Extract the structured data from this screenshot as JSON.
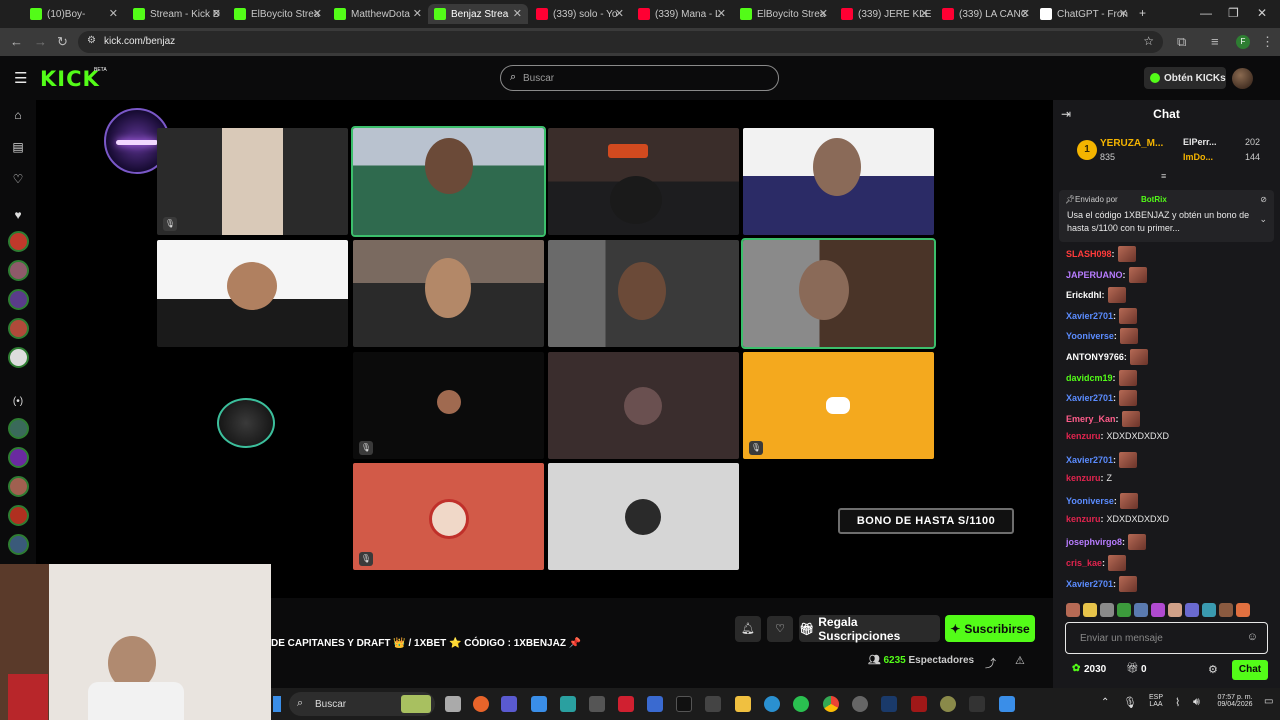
{
  "browser": {
    "tabs": [
      {
        "title": "(10)Boy-",
        "color": "#53fc18"
      },
      {
        "title": "Stream - Kick D",
        "color": "#53fc18"
      },
      {
        "title": "ElBoycito Strea",
        "color": "#53fc18"
      },
      {
        "title": "MatthewDota",
        "color": "#53fc18"
      },
      {
        "title": "Benjaz Strea",
        "color": "#53fc18",
        "active": true
      },
      {
        "title": "(339) solo - Yo",
        "color": "#ff0033"
      },
      {
        "title": "(339) Mana - L",
        "color": "#ff0033"
      },
      {
        "title": "ElBoycito Strea",
        "color": "#53fc18"
      },
      {
        "title": "(339) JERE KLE",
        "color": "#ff0033"
      },
      {
        "title": "(339) LA CANC",
        "color": "#ff0033"
      },
      {
        "title": "ChatGPT - Fron",
        "color": "#ffffff"
      }
    ],
    "new_tab": "+",
    "url": "kick.com/benjaz"
  },
  "header": {
    "logo": "KICK",
    "beta": "BETA",
    "search_placeholder": "Buscar",
    "kicks_button": "Obtén KICKs"
  },
  "video": {
    "promo_banner": "BONO DE HASTA S/1100"
  },
  "stream": {
    "title": "DE CAPITANES Y DRAFT 👑  / 1XBET ⭐ CÓDIGO : 1XBENJAZ 📌",
    "gift_label": "Regala Suscripciones",
    "subscribe_label": "Suscribirse",
    "viewers_count": "6235",
    "viewers_label": "Espectadores"
  },
  "chat": {
    "title": "Chat",
    "leaderboard": {
      "rank": "1",
      "top_user": "YERUZA_M...",
      "top_value": "835",
      "others": [
        {
          "name": "ElPerr...",
          "value": "202"
        },
        {
          "name": "ImDo...",
          "value": "144"
        }
      ]
    },
    "pinned": {
      "sent_by_label": "Enviado por",
      "sender": "BotRix",
      "text": "Usa el código 1XBENJAZ y obtén un bono de hasta s/1100 con tu primer..."
    },
    "messages": [
      {
        "user": "SLASH098",
        "color": "#ff3b3b",
        "text": "",
        "emote": true
      },
      {
        "user": "JAPERUANO",
        "color": "#b77cff",
        "text": "",
        "emote": true
      },
      {
        "user": "Erickdhl",
        "color": "#ffffff",
        "text": "",
        "emote": true
      },
      {
        "user": "Xavier2701",
        "color": "#5b8cff",
        "text": "",
        "emote": true
      },
      {
        "user": "Yooniverse",
        "color": "#5b8cff",
        "text": "",
        "emote": true
      },
      {
        "user": "ANTONY9766",
        "color": "#ffffff",
        "text": "",
        "emote": true
      },
      {
        "user": "davidcm19",
        "color": "#53fc18",
        "text": "",
        "emote": true
      },
      {
        "user": "Xavier2701",
        "color": "#5b8cff",
        "text": "",
        "emote": true
      },
      {
        "user": "Emery_Kan",
        "color": "#ff5c8a",
        "text": "",
        "emote": true
      },
      {
        "user": "kenzuru",
        "color": "#e0244e",
        "text": "XDXDXDXDXD",
        "emote": false
      },
      {
        "user": "Xavier2701",
        "color": "#5b8cff",
        "text": "",
        "emote": true
      },
      {
        "user": "kenzuru",
        "color": "#e0244e",
        "text": "Z",
        "emote": false
      },
      {
        "user": "Yooniverse",
        "color": "#5b8cff",
        "text": "",
        "emote": true
      },
      {
        "user": "kenzuru",
        "color": "#e0244e",
        "text": "XDXDXDXDXD",
        "emote": false
      },
      {
        "user": "josephvirgo8",
        "color": "#b77cff",
        "text": "",
        "emote": true
      },
      {
        "user": "cris_kae",
        "color": "#e0244e",
        "text": "",
        "emote": true
      },
      {
        "user": "Xavier2701",
        "color": "#5b8cff",
        "text": "",
        "emote": true
      }
    ],
    "input_placeholder": "Enviar un mensaje",
    "points": "2030",
    "gifts_count": "0",
    "send_label": "Chat"
  },
  "taskbar": {
    "search_label": "Buscar",
    "lang_top": "ESP",
    "lang_bottom": "LAA",
    "time": "07:57 p. m.",
    "date": "09/04/2026"
  }
}
